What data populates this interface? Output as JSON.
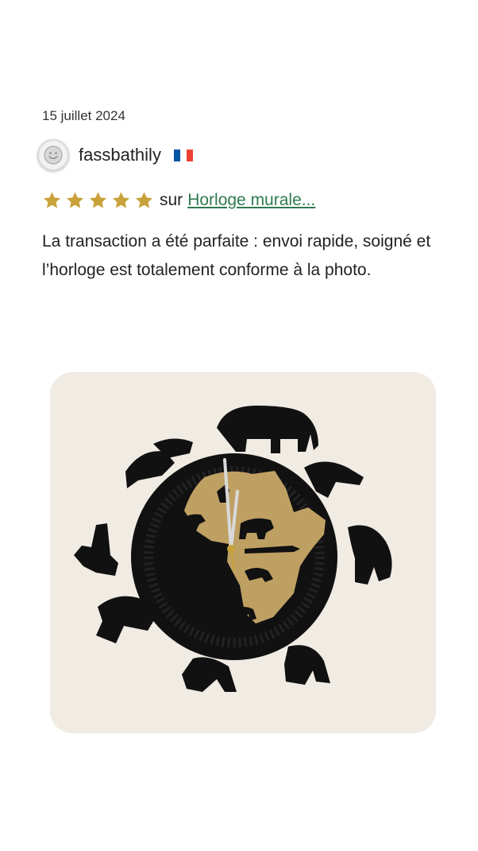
{
  "review": {
    "date": "15 juillet 2024",
    "author": {
      "name": "fassbathily",
      "avatar_icon": "smiley-face-icon",
      "flag_icon": "france-flag-icon",
      "flag_colors": [
        "#0055A4",
        "#FFFFFF",
        "#EF4135"
      ]
    },
    "rating": {
      "stars": 5,
      "max": 5,
      "star_color": "#C8A23A",
      "prefix": "sur",
      "product_link": "Horloge murale..."
    },
    "text": "La transaction a été parfaite : envoi rapide, soigné et l’horloge est totalement conforme à la photo.",
    "photo": {
      "subject": "wall-clock-africa-animals-icon",
      "colors": {
        "background": "#F0EBE3",
        "clock": "#111111",
        "africa": "#BFA063"
      }
    }
  }
}
